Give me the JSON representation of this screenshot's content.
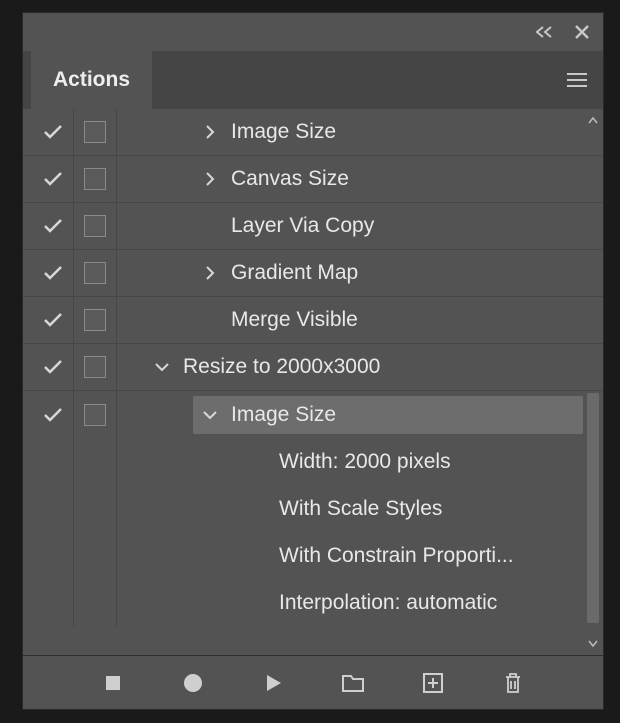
{
  "topbar": {},
  "tab": {
    "label": "Actions"
  },
  "rows": [
    {
      "check": true,
      "dialog": true,
      "indent": 110,
      "toggle": "right",
      "label": "Image Size",
      "sep": true
    },
    {
      "check": true,
      "dialog": true,
      "indent": 110,
      "toggle": "right",
      "label": "Canvas Size",
      "sep": true
    },
    {
      "check": true,
      "dialog": true,
      "indent": 110,
      "toggle": "",
      "label": "Layer Via Copy",
      "sep": true
    },
    {
      "check": true,
      "dialog": true,
      "indent": 110,
      "toggle": "right",
      "label": "Gradient Map",
      "sep": true
    },
    {
      "check": true,
      "dialog": true,
      "indent": 110,
      "toggle": "",
      "label": "Merge Visible",
      "sep": true
    },
    {
      "check": true,
      "dialog": true,
      "indent": 62,
      "toggle": "down",
      "label": "Resize to 2000x3000",
      "sep": true
    },
    {
      "check": true,
      "dialog": true,
      "indent": 110,
      "toggle": "down",
      "label": "Image Size",
      "sep": false,
      "selected": true
    },
    {
      "check": false,
      "dialog": false,
      "indent": 158,
      "toggle": "",
      "label": "Width: 2000 pixels",
      "sep": false
    },
    {
      "check": false,
      "dialog": false,
      "indent": 158,
      "toggle": "",
      "label": "With Scale Styles",
      "sep": false
    },
    {
      "check": false,
      "dialog": false,
      "indent": 158,
      "toggle": "",
      "label": "With Constrain Proporti...",
      "sep": false
    },
    {
      "check": false,
      "dialog": false,
      "indent": 158,
      "toggle": "",
      "label": "Interpolation: automatic",
      "sep": false
    }
  ]
}
